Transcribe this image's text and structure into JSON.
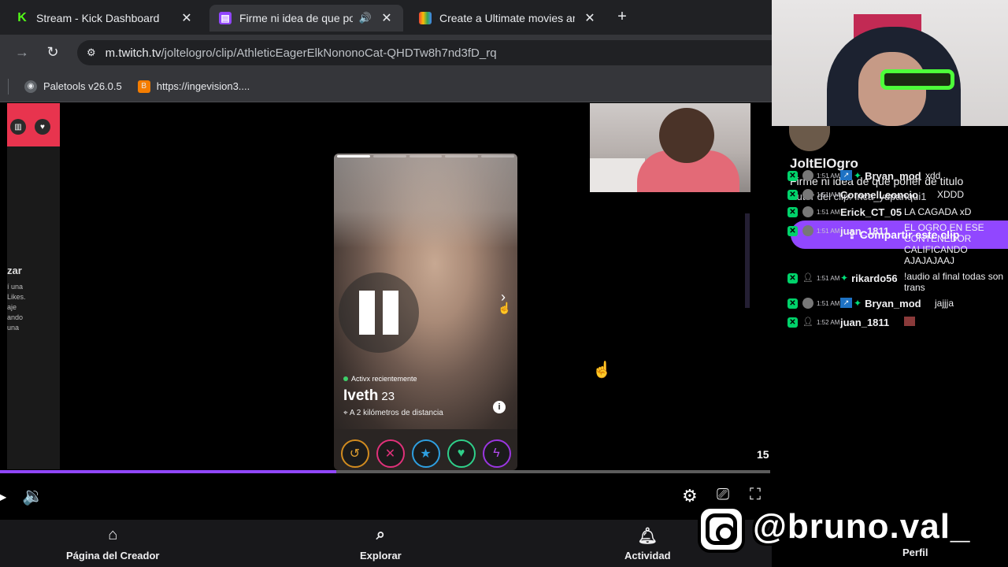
{
  "tabs": [
    {
      "title": "Stream - Kick Dashboard",
      "favicon": "kick-icon",
      "color": "#53fc18"
    },
    {
      "title": "Firme ni idea de que poner",
      "favicon": "twitch-icon",
      "color": "#9146ff",
      "active": true
    },
    {
      "title": "Create a Ultimate movies and li",
      "favicon": "sheets-icon",
      "color": "#f4b400"
    }
  ],
  "address_bar": {
    "host": "m.twitch.tv",
    "path": "/joltelogro/clip/AthleticEagerElkNononoCat-QHDTw8h7nd3fD_rq"
  },
  "bookmarks": [
    {
      "label": "Paletools v26.0.5",
      "icon": "globe-icon"
    },
    {
      "label": "https://ingevision3....",
      "icon": "blogger-icon"
    }
  ],
  "left_panel": {
    "heading": "zar",
    "lines": [
      "í una",
      "Likes.",
      "aje",
      "ando",
      "una"
    ]
  },
  "profile_card": {
    "status": "Activx recientemente",
    "name": "Iveth",
    "age": "23",
    "distance": "A 2 kilómetros de distancia",
    "actions": [
      "rewind-icon",
      "nope-icon",
      "superlike-icon",
      "like-icon",
      "boost-icon"
    ]
  },
  "player": {
    "counter": "15",
    "progress_fraction": 0.437
  },
  "bottom_nav": {
    "creator": "Página del Creador",
    "explore": "Explorar",
    "activity": "Actividad",
    "profile": "Perfil"
  },
  "clip_info": {
    "channel": "JoltElOgro",
    "title": "Firme ni idea de que poner de titulo",
    "author": "Autor del clip: inca_yupanqui1",
    "share_label": "Compartir este clip"
  },
  "chat": [
    {
      "time": "1:51 AM",
      "user": "Bryan_mod",
      "text": "xdd",
      "badges": true
    },
    {
      "time": "1:51 AM",
      "user": "CoronelLeoncio",
      "text": "XDDD",
      "badges": false
    },
    {
      "time": "1:51 AM",
      "user": "Erick_CT_05",
      "text": "LA CAGADA xD",
      "badges": false
    },
    {
      "time": "1:51 AM",
      "user": "juan_1811",
      "text": "EL OGRO EN ESE CONTENEDOR CALIFICANDO AJAJAJAAJ",
      "badges": false
    },
    {
      "time": "1:51 AM",
      "user": "rikardo56",
      "text": "!audio al final todas son trans",
      "badges": false
    },
    {
      "time": "1:51 AM",
      "user": "Bryan_mod",
      "text": "jajjja",
      "badges": true
    },
    {
      "time": "1:52 AM",
      "user": "juan_1811",
      "text": "",
      "badges": false
    }
  ],
  "watermark": {
    "handle": "@bruno.val_"
  }
}
